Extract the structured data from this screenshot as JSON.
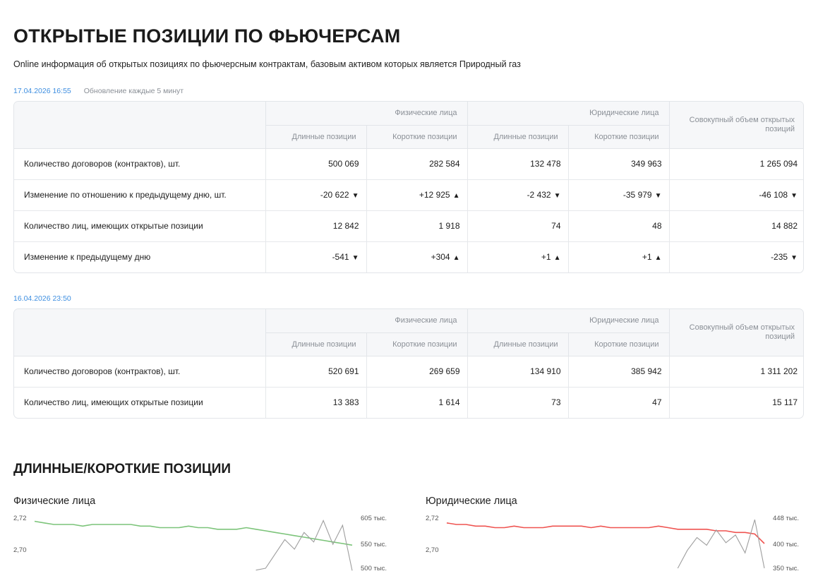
{
  "page": {
    "title": "ОТКРЫТЫЕ ПОЗИЦИИ ПО ФЬЮЧЕРСАМ",
    "subtitle": "Online информация об открытых позициях по фьючерсным контрактам, базовым активом которых является Природный газ",
    "section_title": "ДЛИННЫЕ/КОРОТКИЕ ПОЗИЦИИ"
  },
  "headers": {
    "individuals": "Физические лица",
    "legal": "Юридические лица",
    "long": "Длинные позиции",
    "short": "Короткие позиции",
    "total": "Совокупный объем открытых позиций"
  },
  "current": {
    "date": "17.04.2026 16:55",
    "update_note": "Обновление каждые 5 минут",
    "rows": [
      {
        "label": "Количество договоров (контрактов), шт.",
        "cells": [
          {
            "v": "500 069"
          },
          {
            "v": "282 584"
          },
          {
            "v": "132 478"
          },
          {
            "v": "349 963"
          },
          {
            "v": "1 265 094"
          }
        ]
      },
      {
        "label": "Изменение по отношению к предыдущему дню, шт.",
        "cells": [
          {
            "v": "-20 622",
            "dir": "down"
          },
          {
            "v": "+12 925",
            "dir": "up"
          },
          {
            "v": "-2 432",
            "dir": "down"
          },
          {
            "v": "-35 979",
            "dir": "down"
          },
          {
            "v": "-46 108",
            "dir": "down"
          }
        ]
      },
      {
        "label": "Количество лиц, имеющих открытые позиции",
        "cells": [
          {
            "v": "12 842"
          },
          {
            "v": "1 918"
          },
          {
            "v": "74"
          },
          {
            "v": "48"
          },
          {
            "v": "14 882"
          }
        ]
      },
      {
        "label": "Изменение к предыдущему дню",
        "cells": [
          {
            "v": "-541",
            "dir": "down"
          },
          {
            "v": "+304",
            "dir": "up"
          },
          {
            "v": "+1",
            "dir": "up"
          },
          {
            "v": "+1",
            "dir": "up"
          },
          {
            "v": "-235",
            "dir": "down"
          }
        ]
      }
    ]
  },
  "previous": {
    "date": "16.04.2026 23:50",
    "rows": [
      {
        "label": "Количество договоров (контрактов), шт.",
        "cells": [
          {
            "v": "520 691"
          },
          {
            "v": "269 659"
          },
          {
            "v": "134 910"
          },
          {
            "v": "385 942"
          },
          {
            "v": "1 311 202"
          }
        ]
      },
      {
        "label": "Количество лиц, имеющих открытые позиции",
        "cells": [
          {
            "v": "13 383"
          },
          {
            "v": "1 614"
          },
          {
            "v": "73"
          },
          {
            "v": "47"
          },
          {
            "v": "15 117"
          }
        ]
      }
    ]
  },
  "colors": {
    "negative": "#e5342b",
    "positive": "#2e9e3e",
    "date_link": "#3d8ee0",
    "individuals_line": "#7cc47a",
    "legal_line": "#ef5350",
    "volume_line": "#9e9e9e"
  },
  "chart_data": [
    {
      "type": "line",
      "title": "Физические лица",
      "left_axis_ticks": [
        "2,72",
        "2,70"
      ],
      "right_axis_ticks": [
        "605 тыс.",
        "550 тыс.",
        "500 тыс."
      ],
      "ylim_left": [
        2.695,
        2.725
      ],
      "ylim_right": [
        490,
        610
      ],
      "series": [
        {
          "axis": "left",
          "color": "#7cc47a",
          "values": [
            2.718,
            2.717,
            2.716,
            2.716,
            2.716,
            2.715,
            2.716,
            2.716,
            2.716,
            2.716,
            2.716,
            2.715,
            2.715,
            2.714,
            2.714,
            2.714,
            2.715,
            2.714,
            2.714,
            2.713,
            2.713,
            2.713,
            2.714,
            2.713,
            2.712,
            2.711,
            2.71,
            2.709,
            2.708,
            2.707,
            2.706,
            2.705,
            2.704,
            2.703
          ]
        },
        {
          "axis": "right",
          "color": "#9e9e9e",
          "values": [
            null,
            null,
            null,
            null,
            null,
            null,
            null,
            null,
            null,
            null,
            null,
            null,
            null,
            null,
            null,
            null,
            null,
            null,
            null,
            null,
            null,
            null,
            null,
            496,
            500,
            530,
            560,
            540,
            575,
            555,
            600,
            550,
            590,
            495
          ]
        }
      ]
    },
    {
      "type": "line",
      "title": "Юридические лица",
      "left_axis_ticks": [
        "2,72",
        "2,70"
      ],
      "right_axis_ticks": [
        "448 тыс.",
        "400 тыс.",
        "350 тыс."
      ],
      "ylim_left": [
        2.695,
        2.725
      ],
      "ylim_right": [
        340,
        455
      ],
      "series": [
        {
          "axis": "left",
          "color": "#ef5350",
          "values": [
            2.717,
            2.716,
            2.716,
            2.715,
            2.715,
            2.714,
            2.714,
            2.715,
            2.714,
            2.714,
            2.714,
            2.715,
            2.715,
            2.715,
            2.715,
            2.714,
            2.715,
            2.714,
            2.714,
            2.714,
            2.714,
            2.714,
            2.715,
            2.714,
            2.713,
            2.713,
            2.713,
            2.713,
            2.712,
            2.712,
            2.711,
            2.711,
            2.71,
            2.704
          ]
        },
        {
          "axis": "right",
          "color": "#9e9e9e",
          "values": [
            null,
            null,
            null,
            null,
            null,
            null,
            null,
            null,
            null,
            null,
            null,
            null,
            null,
            null,
            null,
            null,
            null,
            null,
            null,
            null,
            null,
            null,
            null,
            null,
            350,
            385,
            410,
            395,
            425,
            400,
            415,
            380,
            445,
            350
          ]
        }
      ]
    }
  ]
}
